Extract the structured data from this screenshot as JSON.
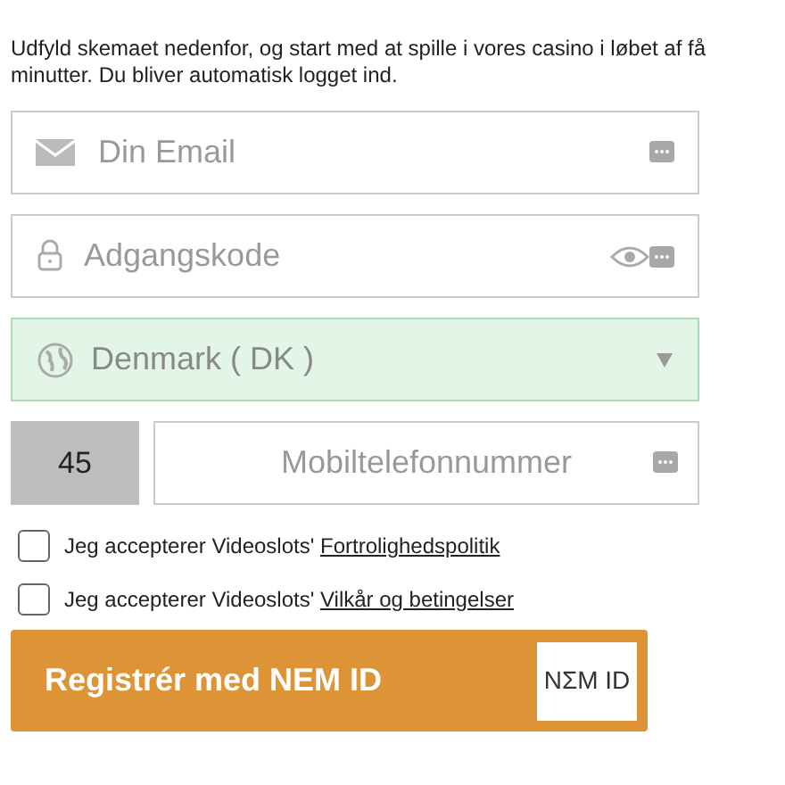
{
  "intro": "Udfyld skemaet nedenfor, og start med at spille i vores casino i løbet af få minutter. Du bliver automatisk logget ind.",
  "email": {
    "placeholder": "Din Email"
  },
  "password": {
    "placeholder": "Adgangskode"
  },
  "country": {
    "value": "Denmark ( DK )",
    "valid": true
  },
  "phone": {
    "prefix": "45",
    "placeholder": "Mobiltelefonnummer"
  },
  "consents": [
    {
      "text": "Jeg accepterer Videoslots' ",
      "link": "Fortrolighedspolitik",
      "checked": false
    },
    {
      "text": "Jeg accepterer Videoslots' ",
      "link": "Vilkår og betingelser",
      "checked": false
    }
  ],
  "submit": {
    "label": "Registrér med NEM ID",
    "logo": "NΣM ID"
  }
}
